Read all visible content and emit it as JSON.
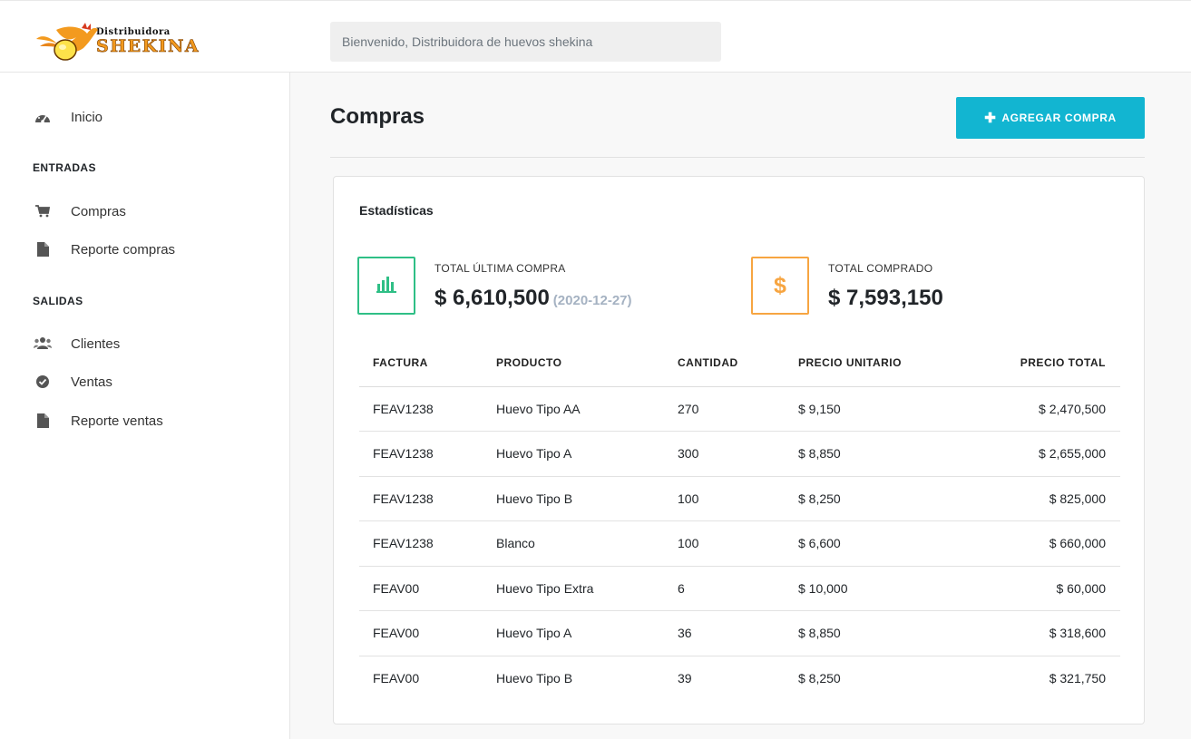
{
  "header": {
    "logo": {
      "line1": "Distribuidora",
      "line2": "SHEKINA"
    },
    "welcome": "Bienvenido, Distribuidora de huevos shekina"
  },
  "sidebar": {
    "home": {
      "label": "Inicio",
      "icon": "dashboard-icon"
    },
    "sections": [
      {
        "title": "ENTRADAS",
        "items": [
          {
            "label": "Compras",
            "icon": "cart-icon"
          },
          {
            "label": "Reporte compras",
            "icon": "file-icon"
          }
        ]
      },
      {
        "title": "SALIDAS",
        "items": [
          {
            "label": "Clientes",
            "icon": "users-icon"
          },
          {
            "label": "Ventas",
            "icon": "check-circle-icon"
          },
          {
            "label": "Reporte ventas",
            "icon": "file-icon"
          }
        ]
      }
    ]
  },
  "main": {
    "title": "Compras",
    "add_button": "AGREGAR COMPRA",
    "card_title": "Estadísticas",
    "stats": {
      "last_purchase": {
        "label": "TOTAL ÚLTIMA COMPRA",
        "value": "$ 6,610,500",
        "date": "(2020-12-27)",
        "color": "#2fbf86",
        "icon": "bar-chart-icon"
      },
      "total": {
        "label": "TOTAL COMPRADO",
        "value": "$ 7,593,150",
        "color": "#f7a541",
        "icon": "dollar-icon",
        "symbol": "$"
      }
    },
    "table": {
      "headers": [
        "FACTURA",
        "PRODUCTO",
        "CANTIDAD",
        "PRECIO UNITARIO",
        "PRECIO TOTAL"
      ],
      "rows": [
        [
          "FEAV1238",
          "Huevo Tipo AA",
          "270",
          "$ 9,150",
          "$ 2,470,500"
        ],
        [
          "FEAV1238",
          "Huevo Tipo A",
          "300",
          "$ 8,850",
          "$ 2,655,000"
        ],
        [
          "FEAV1238",
          "Huevo Tipo B",
          "100",
          "$ 8,250",
          "$ 825,000"
        ],
        [
          "FEAV1238",
          "Blanco",
          "100",
          "$ 6,600",
          "$ 660,000"
        ],
        [
          "FEAV00",
          "Huevo Tipo Extra",
          "6",
          "$ 10,000",
          "$ 60,000"
        ],
        [
          "FEAV00",
          "Huevo Tipo A",
          "36",
          "$ 8,850",
          "$ 318,600"
        ],
        [
          "FEAV00",
          "Huevo Tipo B",
          "39",
          "$ 8,250",
          "$ 321,750"
        ]
      ]
    },
    "accent_color": "#12b5d1"
  }
}
